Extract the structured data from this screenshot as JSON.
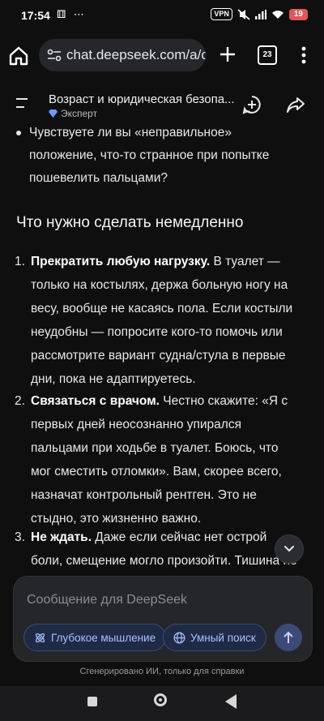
{
  "status_bar": {
    "time": "17:54",
    "left_icons": "⚅ ⋯",
    "vpn": "VPN",
    "battery": "19"
  },
  "browser": {
    "url": "chat.deepseek.com/a/cl",
    "tab_count": "23"
  },
  "chat": {
    "title": "Возраст и юридическая безопа...",
    "mode": "Эксперт",
    "bullet_text": "Чувствуете ли вы «неправильное» положение, что-то странное при попытке пошевелить пальцами?",
    "heading": "Что нужно сделать немедленно",
    "steps": [
      {
        "num": "1.",
        "bold": "Прекратить любую нагрузку.",
        "text": " В туалет — только на костылях, держа больную ногу на весу, вообще не касаясь пола. Если костыли неудобны — попросите кого-то помочь или рассмотрите вариант судна/стула в первые дни, пока не адаптируетесь."
      },
      {
        "num": "2.",
        "bold": "Связаться с врачом.",
        "text": " Честно скажите: «Я с первых дней неосознанно упирался пальцами при ходьбе в туалет. Боюсь, что мог сместить отломки». Вам, скорее всего, назначат контрольный рентген. Это не стыдно, это жизненно важно."
      },
      {
        "num": "3.",
        "bold": "Не ждать.",
        "text": " Даже если сейчас нет острой боли, смещение могло произойти. Тишина не"
      }
    ]
  },
  "composer": {
    "placeholder": "Сообщение для DeepSeek",
    "deep_think": "Глубокое мышление",
    "smart_search": "Умный поиск"
  },
  "footer": {
    "disclaimer": "Сгенерировано ИИ, только для справки"
  },
  "colors": {
    "background": "#0f0f10",
    "accent": "#4d6bfe",
    "pill_text": "#a8c1ff"
  }
}
